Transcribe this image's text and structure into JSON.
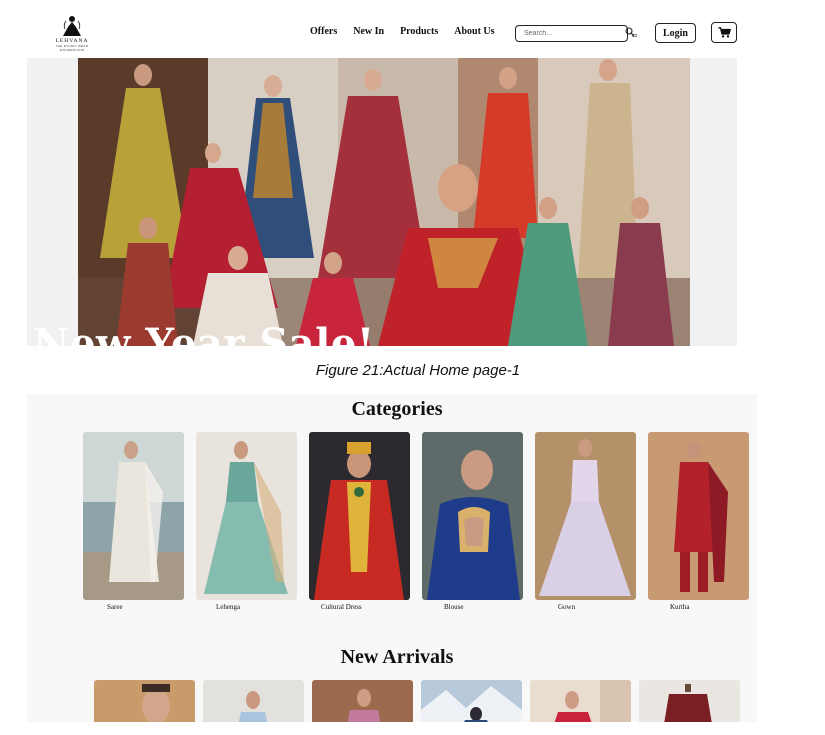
{
  "brand": {
    "name": "LEHVANA",
    "tagline": "THE ETHNIC WEAR WONDERLAND"
  },
  "nav": {
    "items": [
      "Offers",
      "New In",
      "Products",
      "About Us"
    ]
  },
  "search": {
    "placeholder": "Search..."
  },
  "header": {
    "login_label": "Login",
    "cart_icon": "cart-icon"
  },
  "hero": {
    "sale_text": "New Year Sale!"
  },
  "caption": "Figure 21:Actual Home page-1",
  "categories": {
    "title": "Categories",
    "items": [
      {
        "label": "Saree",
        "color": "#c9c2b4"
      },
      {
        "label": "Lehenga",
        "color": "#7fb6ac"
      },
      {
        "label": "Cultural Dress",
        "color": "#c0392b"
      },
      {
        "label": "Blouse",
        "color": "#1f3c8a"
      },
      {
        "label": "Gown",
        "color": "#d9cfe6"
      },
      {
        "label": "Kurtha",
        "color": "#b3222a"
      }
    ]
  },
  "new_arrivals": {
    "title": "New Arrivals"
  },
  "colors": {
    "page_bg": "#ffffff",
    "section_bg": "#f8f8f9",
    "hero_bg": "#f1f1f1",
    "text": "#111111"
  }
}
